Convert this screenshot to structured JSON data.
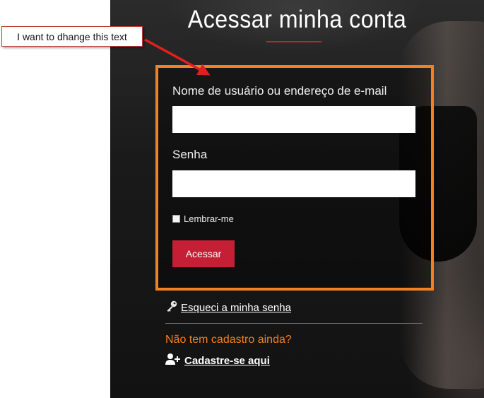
{
  "page": {
    "title": "Acessar minha conta",
    "accent_color": "#c41f35",
    "highlight_color": "#f4801f"
  },
  "login_form": {
    "username_label": "Nome de usuário ou endereço de e-mail",
    "username_value": "",
    "password_label": "Senha",
    "password_value": "",
    "remember_label": "Lembrar-me",
    "remember_checked": false,
    "submit_label": "Acessar"
  },
  "links": {
    "lost_password_icon": "key-icon",
    "lost_password_label": "Esqueci a minha senha",
    "signup_prompt": "Não tem cadastro ainda?",
    "signup_icon": "user-plus-icon",
    "signup_label": "Cadastre-se aqui"
  },
  "annotation": {
    "callout_text": "I want to dhange this text",
    "callout_color": "#e02020"
  }
}
